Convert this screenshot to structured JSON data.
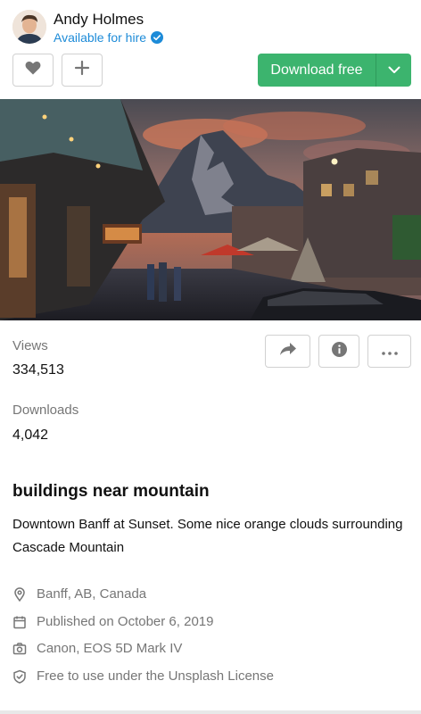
{
  "author": {
    "name": "Andy Holmes",
    "status": "Available for hire"
  },
  "toolbar": {
    "download_label": "Download free"
  },
  "stats": {
    "views_label": "Views",
    "views_value": "334,513",
    "downloads_label": "Downloads",
    "downloads_value": "4,042"
  },
  "photo": {
    "title": "buildings near mountain",
    "description": "Downtown Banff at Sunset. Some nice orange clouds surrounding Cascade Mountain"
  },
  "meta": {
    "location": "Banff, AB, Canada",
    "published": "Published on October 6, 2019",
    "camera": "Canon, EOS 5D Mark IV",
    "license": "Free to use under the Unsplash License"
  },
  "colors": {
    "accent_green": "#3cb46e",
    "link_blue": "#1d8bd8",
    "muted": "#767676"
  },
  "icons": [
    "heart-icon",
    "plus-icon",
    "chevron-down-icon",
    "share-icon",
    "info-icon",
    "more-icon",
    "location-icon",
    "calendar-icon",
    "camera-icon",
    "shield-icon",
    "verified-icon"
  ]
}
